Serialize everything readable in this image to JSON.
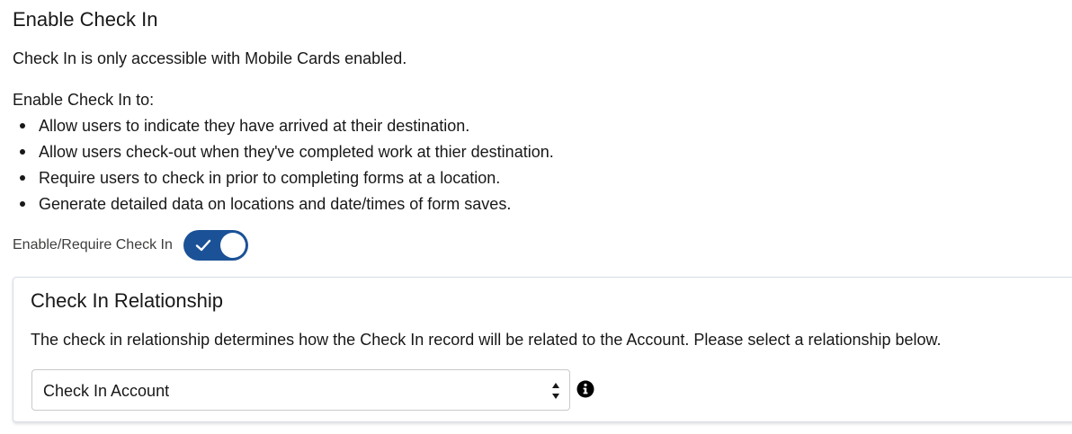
{
  "section": {
    "title": "Enable Check In",
    "notice": "Check In is only accessible with Mobile Cards enabled.",
    "intro": "Enable Check In to:",
    "bullets": [
      "Allow users to indicate they have arrived at their destination.",
      "Allow users check-out when they've completed work at thier destination.",
      "Require users to check in prior to completing forms at a location.",
      "Generate detailed data on locations and date/times of form saves."
    ]
  },
  "toggle": {
    "label": "Enable/Require Check In",
    "checked": true,
    "accent_color": "#1b5297",
    "icon": "check-icon"
  },
  "relationship": {
    "title": "Check In Relationship",
    "description": "The check in relationship determines how the Check In record will be related to the Account. Please select a relationship below.",
    "select_value": "Check In Account",
    "select_icon": "sort-arrows-icon",
    "info_icon": "info-icon"
  }
}
